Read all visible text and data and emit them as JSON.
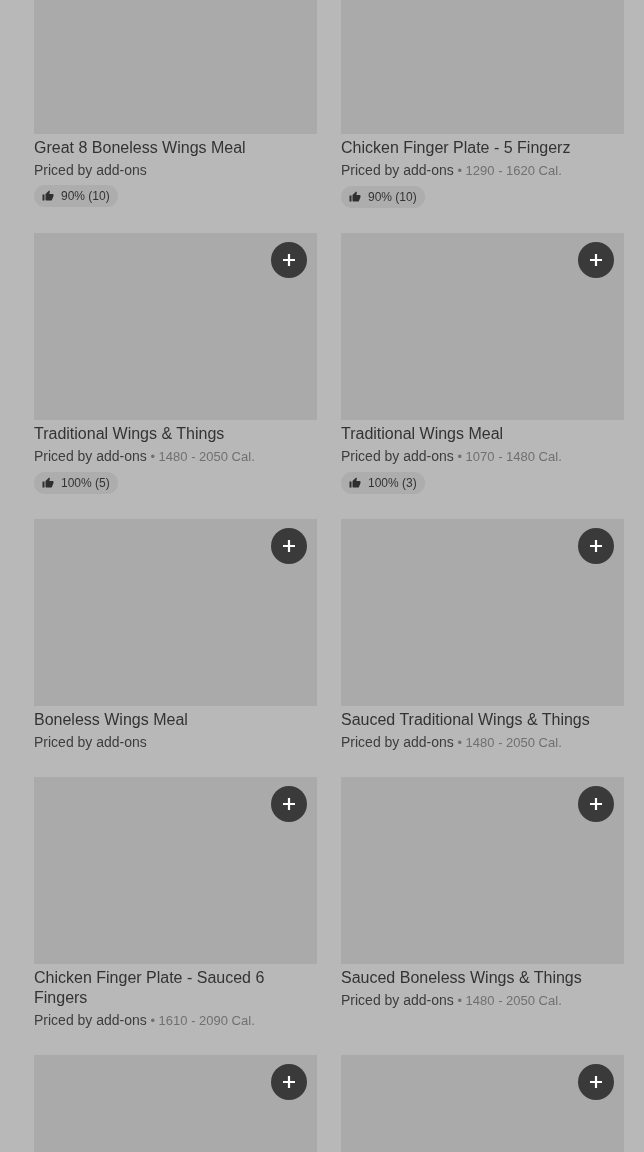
{
  "items": [
    {
      "kind": "dish",
      "name": "Great 8 Boneless Wings Meal",
      "price": "Priced by add-ons",
      "rating": "90% (10)"
    },
    {
      "kind": "dish",
      "name": "Chicken Finger Plate - 5 Fingerz",
      "price": "Priced by add-ons",
      "calories": "• 1290 - 1620 Cal.",
      "rating": "90% (10)"
    },
    {
      "kind": "dish",
      "name": "Traditional Wings & Things",
      "price": "Priced by add-ons",
      "calories": "• 1480 - 2050 Cal.",
      "rating": "100% (5)"
    },
    {
      "kind": "dish",
      "name": "Traditional Wings Meal",
      "price": "Priced by add-ons",
      "calories": "• 1070 - 1480 Cal.",
      "rating": "100% (3)"
    },
    {
      "kind": "dish",
      "name": "Boneless Wings Meal",
      "price": "Priced by add-ons"
    },
    {
      "kind": "dish",
      "name": "Sauced Traditional Wings & Things",
      "price": "Priced by add-ons",
      "calories": "• 1480 - 2050 Cal."
    },
    {
      "kind": "dish",
      "name": "Chicken Finger Plate - Sauced 6 Fingers",
      "price": "Priced by add-ons",
      "calories": "• 1610 - 2090 Cal."
    },
    {
      "kind": "dish",
      "name": "Sauced Boneless Wings & Things",
      "price": "Priced by add-ons",
      "calories": "• 1480 - 2050 Cal."
    },
    {
      "kind": "image_only"
    },
    {
      "kind": "image_only"
    }
  ]
}
